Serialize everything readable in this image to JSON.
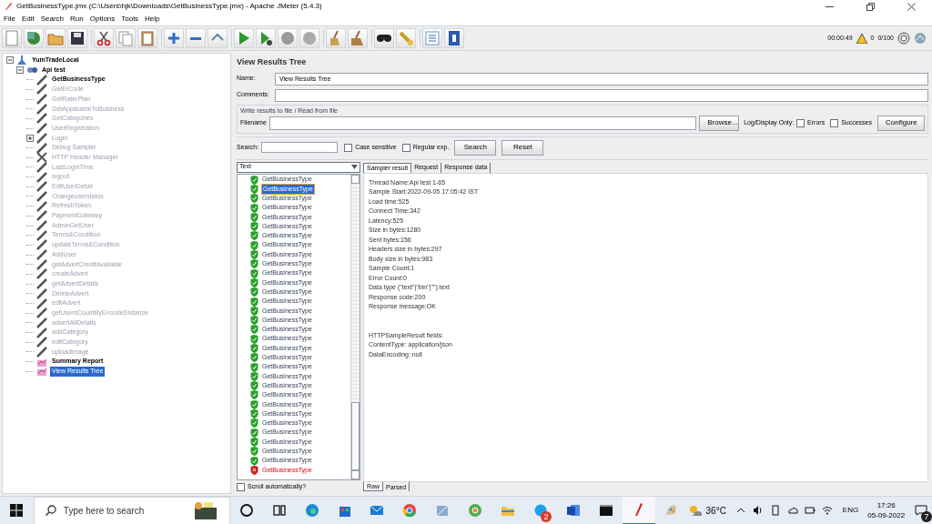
{
  "window": {
    "title": "GetBusinessType.jmx (C:\\Users\\hjk\\Downloads\\GetBusinessType.jmx) - Apache JMeter (5.4.3)"
  },
  "menu": [
    "File",
    "Edit",
    "Search",
    "Run",
    "Options",
    "Tools",
    "Help"
  ],
  "toolbar_status": {
    "elapsed": "00:00:49",
    "warnings": "0",
    "threads": "0/100"
  },
  "tree": [
    {
      "label": "YumTradeLocal",
      "kind": "plan",
      "expanded": true,
      "disabled": false,
      "selected": false,
      "children": [
        {
          "label": "Api test",
          "kind": "thread-group",
          "expanded": true,
          "disabled": false,
          "selected": false,
          "children": [
            {
              "label": "GetBusinessType",
              "kind": "sampler",
              "disabled": false,
              "selected": false
            },
            {
              "label": "GetErCode",
              "kind": "sampler",
              "disabled": true,
              "selected": false
            },
            {
              "label": "GetRaterPlan",
              "kind": "sampler",
              "disabled": true,
              "selected": false
            },
            {
              "label": "GetApplicableToBusiness",
              "kind": "sampler",
              "disabled": true,
              "selected": false
            },
            {
              "label": "GetCategories",
              "kind": "sampler",
              "disabled": true,
              "selected": false
            },
            {
              "label": "UserRegistration",
              "kind": "sampler",
              "disabled": true,
              "selected": false
            },
            {
              "label": "Login",
              "kind": "sampler",
              "expanded": false,
              "disabled": true,
              "selected": false
            },
            {
              "label": "Debug Sampler",
              "kind": "sampler",
              "disabled": true,
              "selected": false
            },
            {
              "label": "HTTP Header Manager",
              "kind": "config",
              "disabled": true,
              "selected": false
            },
            {
              "label": "LastLoginTime",
              "kind": "sampler",
              "disabled": true,
              "selected": false
            },
            {
              "label": "logout",
              "kind": "sampler",
              "disabled": true,
              "selected": false
            },
            {
              "label": "EditUserDetail",
              "kind": "sampler",
              "disabled": true,
              "selected": false
            },
            {
              "label": "Changeuserstatus",
              "kind": "sampler",
              "disabled": true,
              "selected": false
            },
            {
              "label": "RefreshToken",
              "kind": "sampler",
              "disabled": true,
              "selected": false
            },
            {
              "label": "PaymentGateway",
              "kind": "sampler",
              "disabled": true,
              "selected": false
            },
            {
              "label": "AdminGetUser",
              "kind": "sampler",
              "disabled": true,
              "selected": false
            },
            {
              "label": "Terms&Condition",
              "kind": "sampler",
              "disabled": true,
              "selected": false
            },
            {
              "label": "updateTerms&Condition",
              "kind": "sampler",
              "disabled": true,
              "selected": false
            },
            {
              "label": "AddUser",
              "kind": "sampler",
              "disabled": true,
              "selected": false
            },
            {
              "label": "getAdvertCreditAvailable",
              "kind": "sampler",
              "disabled": true,
              "selected": false
            },
            {
              "label": "createAdvert",
              "kind": "sampler",
              "disabled": true,
              "selected": false
            },
            {
              "label": "getAdvertDetails",
              "kind": "sampler",
              "disabled": true,
              "selected": false
            },
            {
              "label": "DeleteAdvert",
              "kind": "sampler",
              "disabled": true,
              "selected": false
            },
            {
              "label": "editAdvert",
              "kind": "sampler",
              "disabled": true,
              "selected": false
            },
            {
              "label": "getUsersCountByEncodeDistance",
              "kind": "sampler",
              "disabled": true,
              "selected": false
            },
            {
              "label": "advertAllDetails",
              "kind": "sampler",
              "disabled": true,
              "selected": false
            },
            {
              "label": "addCategory",
              "kind": "sampler",
              "disabled": true,
              "selected": false
            },
            {
              "label": "editCategory",
              "kind": "sampler",
              "disabled": true,
              "selected": false
            },
            {
              "label": "uploadImage",
              "kind": "sampler",
              "disabled": true,
              "selected": false
            },
            {
              "label": "Summary Report",
              "kind": "listener",
              "disabled": false,
              "selected": false
            },
            {
              "label": "View Results Tree",
              "kind": "listener",
              "disabled": false,
              "selected": true
            }
          ]
        }
      ]
    }
  ],
  "panel": {
    "title": "View Results Tree",
    "name_label": "Name:",
    "name_value": "View Results Tree",
    "comments_label": "Comments:",
    "file_group": {
      "legend": "Write results to file / Read from file",
      "filename_label": "Filename",
      "browse": "Browse...",
      "log_label": "Log/Display Only:",
      "options": [
        {
          "label": "Errors",
          "checked": false
        },
        {
          "label": "Successes",
          "checked": false
        }
      ],
      "configure": "Configure"
    },
    "search": {
      "label": "Search:",
      "options": [
        {
          "label": "Case sensitive",
          "checked": false
        },
        {
          "label": "Regular exp.",
          "checked": false
        }
      ],
      "search_button": "Search",
      "reset_button": "Reset"
    },
    "renderer": "Text",
    "results": [
      {
        "label": "GetBusinessType",
        "success": true,
        "selected": false
      },
      {
        "label": "GetBusinessType",
        "success": true,
        "selected": true
      },
      {
        "label": "GetBusinessType",
        "success": true,
        "selected": false
      },
      {
        "label": "GetBusinessType",
        "success": true,
        "selected": false
      },
      {
        "label": "GetBusinessType",
        "success": true,
        "selected": false
      },
      {
        "label": "GetBusinessType",
        "success": true,
        "selected": false
      },
      {
        "label": "GetBusinessType",
        "success": true,
        "selected": false
      },
      {
        "label": "GetBusinessType",
        "success": true,
        "selected": false
      },
      {
        "label": "GetBusinessType",
        "success": true,
        "selected": false
      },
      {
        "label": "GetBusinessType",
        "success": true,
        "selected": false
      },
      {
        "label": "GetBusinessType",
        "success": true,
        "selected": false
      },
      {
        "label": "GetBusinessType",
        "success": true,
        "selected": false
      },
      {
        "label": "GetBusinessType",
        "success": true,
        "selected": false
      },
      {
        "label": "GetBusinessType",
        "success": true,
        "selected": false
      },
      {
        "label": "GetBusinessType",
        "success": true,
        "selected": false
      },
      {
        "label": "GetBusinessType",
        "success": true,
        "selected": false
      },
      {
        "label": "GetBusinessType",
        "success": true,
        "selected": false
      },
      {
        "label": "GetBusinessType",
        "success": true,
        "selected": false
      },
      {
        "label": "GetBusinessType",
        "success": true,
        "selected": false
      },
      {
        "label": "GetBusinessType",
        "success": true,
        "selected": false
      },
      {
        "label": "GetBusinessType",
        "success": true,
        "selected": false
      },
      {
        "label": "GetBusinessType",
        "success": true,
        "selected": false
      },
      {
        "label": "GetBusinessType",
        "success": true,
        "selected": false
      },
      {
        "label": "GetBusinessType",
        "success": true,
        "selected": false
      },
      {
        "label": "GetBusinessType",
        "success": true,
        "selected": false
      },
      {
        "label": "GetBusinessType",
        "success": true,
        "selected": false
      },
      {
        "label": "GetBusinessType",
        "success": true,
        "selected": false
      },
      {
        "label": "GetBusinessType",
        "success": true,
        "selected": false
      },
      {
        "label": "GetBusinessType",
        "success": true,
        "selected": false
      },
      {
        "label": "GetBusinessType",
        "success": true,
        "selected": false
      },
      {
        "label": "GetBusinessType",
        "success": true,
        "selected": false
      },
      {
        "label": "GetBusinessType",
        "success": false,
        "selected": false
      }
    ],
    "scroll_auto": {
      "label": "Scroll automatically?",
      "checked": false
    },
    "tabs": [
      {
        "label": "Sampler result",
        "selected": true
      },
      {
        "label": "Request",
        "selected": false
      },
      {
        "label": "Response data",
        "selected": false
      }
    ],
    "result_blocks": [
      [
        "Thread Name:Api test 1-65",
        "Sample Start:2022-09-05 17:05:42 IST",
        "Load time:525",
        "Connect Time:342",
        "Latency:525",
        "Size in bytes:1280",
        "Sent bytes:156",
        "Headers size in bytes:297",
        "Body size in bytes:983",
        "Sample Count:1",
        "Error Count:0",
        "Data type (\"text\"|\"bin\"|\"\"):text",
        "Response code:200",
        "Response message:OK"
      ],
      [
        "HTTPSampleResult fields:",
        "ContentType: application/json",
        "DataEncoding: null"
      ]
    ],
    "bottom_tabs": [
      {
        "label": "Raw",
        "selected": true
      },
      {
        "label": "Parsed",
        "selected": false
      }
    ]
  },
  "taskbar": {
    "search_placeholder": "Type here to search",
    "badge": "2",
    "temperature": "36°C",
    "language": "ENG",
    "time": "17:26",
    "date": "05-09-2022",
    "notifications": "7"
  }
}
